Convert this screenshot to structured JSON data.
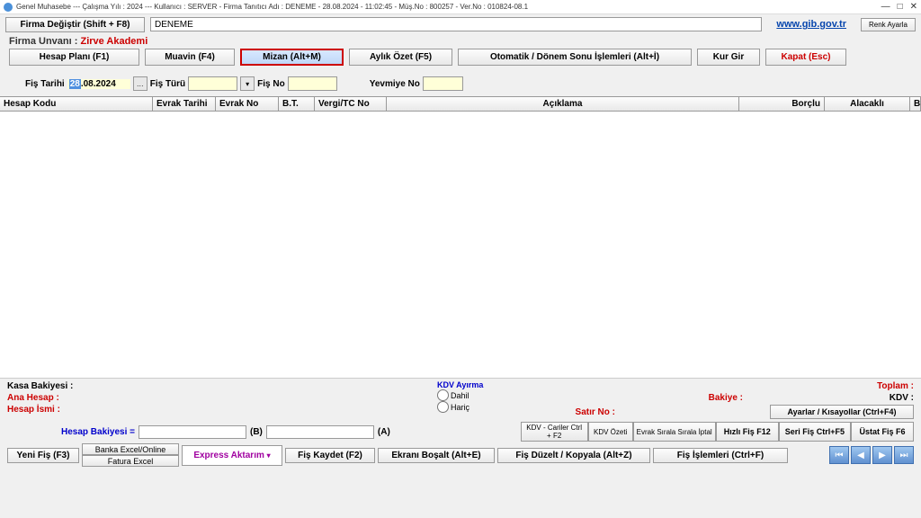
{
  "titlebar": "Genel Muhasebe --- Çalışma Yılı : 2024 --- Kullanıcı : SERVER - Firma Tanıtıcı Adı : DENEME - 28.08.2024 - 11:02:45 - Müş.No : 800257 - Ver.No : 010824-08.1",
  "topbar": {
    "firma_degistir": "Firma Değiştir (Shift + F8)",
    "company": "DENEME",
    "link": "www.gib.gov.tr",
    "renk": "Renk Ayarla"
  },
  "firm": {
    "label": "Firma Unvanı :",
    "name": "Zirve Akademi"
  },
  "main": {
    "hesap": "Hesap Planı (F1)",
    "muavin": "Muavin (F4)",
    "mizan": "Mizan (Alt+M)",
    "aylik": "Aylık Özet (F5)",
    "oto": "Otomatik / Dönem Sonu İşlemleri (Alt+İ)",
    "kur": "Kur Gir",
    "kapat": "Kapat (Esc)"
  },
  "filters": {
    "fis_tarihi": "Fiş Tarihi",
    "date_hl": "28",
    "date_rest": ".08.2024",
    "fis_turu": "Fiş Türü",
    "fis_no": "Fiş No",
    "yevmiye": "Yevmiye No"
  },
  "cols": {
    "hesap": "Hesap Kodu",
    "evtar": "Evrak Tarihi",
    "evno": "Evrak No",
    "bt": "B.T.",
    "vergi": "Vergi/TC No",
    "acik": "Açıklama",
    "borc": "Borçlu",
    "alac": "Alacaklı",
    "b": "B"
  },
  "foot": {
    "kasa": "Kasa Bakiyesi :",
    "ana": "Ana Hesap :",
    "isim": "Hesap İsmi :",
    "kdv_ayirma": "KDV Ayırma",
    "dahil": "Dahil",
    "haric": "Hariç",
    "toplam": "Toplam :",
    "bakiye": "Bakiye :",
    "satir": "Satır No :",
    "kdv": "KDV :",
    "ayarlar": "Ayarlar / Kısayollar (Ctrl+F4)",
    "hesap_bak": "Hesap Bakiyesi =",
    "b": "(B)",
    "a": "(A)",
    "kdv_cariler": "KDV - Cariler Ctrl + F2",
    "kdv_ozeti": "KDV Özeti",
    "evrak_sirala": "Evrak Sırala Sırala İptal",
    "hizli": "Hızlı Fiş F12",
    "seri": "Seri Fiş Ctrl+F5",
    "ustat": "Üstat Fiş F6",
    "yeni": "Yeni Fiş (F3)",
    "banka": "Banka Excel/Online",
    "fatura": "Fatura Excel",
    "express": "Express Aktarım",
    "kaydet": "Fiş Kaydet (F2)",
    "bosalt": "Ekranı Boşalt (Alt+E)",
    "duzelt": "Fiş Düzelt / Kopyala (Alt+Z)",
    "islem": "Fiş İşlemleri (Ctrl+F)"
  }
}
